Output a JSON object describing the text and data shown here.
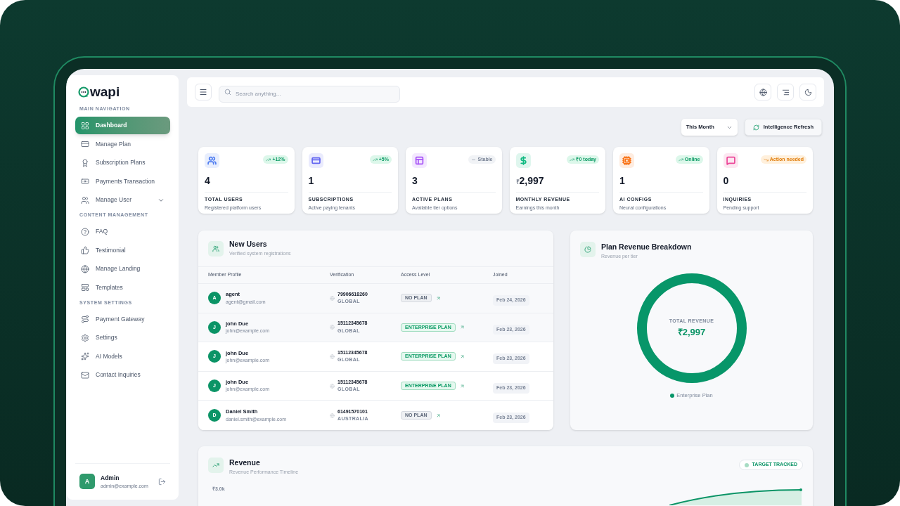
{
  "logo": {
    "text": "wapi"
  },
  "sidebar": {
    "sections": [
      {
        "title": "MAIN NAVIGATION",
        "items": [
          {
            "label": "Dashboard",
            "selected": true
          },
          {
            "label": "Manage Plan",
            "selected": false
          },
          {
            "label": "Subscription Plans",
            "selected": false
          },
          {
            "label": "Payments Transaction",
            "selected": false
          },
          {
            "label": "Manage User",
            "selected": false,
            "expanded": false
          }
        ]
      },
      {
        "title": "CONTENT MANAGEMENT",
        "items": [
          {
            "label": "FAQ",
            "selected": false
          },
          {
            "label": "Testimonial",
            "selected": false
          },
          {
            "label": "Manage Landing",
            "selected": false
          },
          {
            "label": "Templates",
            "selected": false
          }
        ]
      },
      {
        "title": "SYSTEM SETTINGS",
        "items": [
          {
            "label": "Payment Gateway",
            "selected": false
          },
          {
            "label": "Settings",
            "selected": false
          },
          {
            "label": "AI Models",
            "selected": false
          },
          {
            "label": "Contact Inquiries",
            "selected": false
          }
        ]
      }
    ]
  },
  "user": {
    "initial": "A",
    "name": "Admin",
    "email": "admin@example.com"
  },
  "search": {
    "placeholder": "Search anything..."
  },
  "period": {
    "value": "This Month"
  },
  "refresh_button": "Intelligence Refresh",
  "stats": [
    {
      "value": "4",
      "label": "TOTAL USERS",
      "caption": "Registered platform users",
      "badge": "+12%",
      "kind": "up",
      "color": "#4f7df0"
    },
    {
      "value": "1",
      "label": "SUBSCRIPTIONS",
      "caption": "Active paying tenants",
      "badge": "+5%",
      "kind": "up",
      "color": "#6366f1"
    },
    {
      "value": "3",
      "label": "ACTIVE PLANS",
      "caption": "Available tier options",
      "badge": "Stable",
      "kind": "flat",
      "color": "#a855f7"
    },
    {
      "currency": "₹",
      "value": "2,997",
      "label": "MONTHLY REVENUE",
      "caption": "Earnings this month",
      "badge": "₹0 today",
      "kind": "up",
      "color": "#10b981"
    },
    {
      "value": "1",
      "label": "AI CONFIGS",
      "caption": "Neural configurations",
      "badge": "Online",
      "kind": "up",
      "color": "#f97316"
    },
    {
      "value": "0",
      "label": "INQUIRIES",
      "caption": "Pending support",
      "badge": "Action needed",
      "kind": "alert",
      "color": "#ec4899"
    }
  ],
  "new_users": {
    "title": "New Users",
    "subtitle": "Verified system registrations",
    "columns": [
      "Member Profile",
      "Verification",
      "Access Level",
      "Joined"
    ],
    "rows": [
      {
        "initial": "A",
        "name": "agent",
        "email": "agent@gmail.com",
        "phone": "79906618260",
        "region": "GLOBAL",
        "plan": "NO PLAN",
        "kind": "none",
        "joined": "Feb 24, 2026"
      },
      {
        "initial": "J",
        "name": "john Due",
        "email": "john@example.com",
        "phone": "15112345678",
        "region": "GLOBAL",
        "plan": "ENTERPRISE PLAN",
        "kind": "paid",
        "joined": "Feb 23, 2026"
      },
      {
        "initial": "J",
        "name": "john Due",
        "email": "john@example.com",
        "phone": "15112345678",
        "region": "GLOBAL",
        "plan": "ENTERPRISE PLAN",
        "kind": "paid",
        "joined": "Feb 23, 2026"
      },
      {
        "initial": "J",
        "name": "john Due",
        "email": "john@example.com",
        "phone": "15112345678",
        "region": "GLOBAL",
        "plan": "ENTERPRISE PLAN",
        "kind": "paid",
        "joined": "Feb 23, 2026"
      },
      {
        "initial": "D",
        "name": "Daniel Smith",
        "email": "daniel.smith@example.com",
        "phone": "61491570101",
        "region": "AUSTRALIA",
        "plan": "NO PLAN",
        "kind": "none",
        "joined": "Feb 23, 2026"
      }
    ]
  },
  "plan_revenue": {
    "title": "Plan Revenue Breakdown",
    "subtitle": "Revenue per tier",
    "center_label": "TOTAL REVENUE",
    "center_value": "₹2,997",
    "legend": [
      {
        "label": "Enterprise Plan",
        "color": "#079669"
      }
    ]
  },
  "revenue": {
    "title": "Revenue",
    "subtitle": "Revenue Performance Timeline",
    "badge": "TARGET TRACKED",
    "tick": "₹3.0k"
  }
}
